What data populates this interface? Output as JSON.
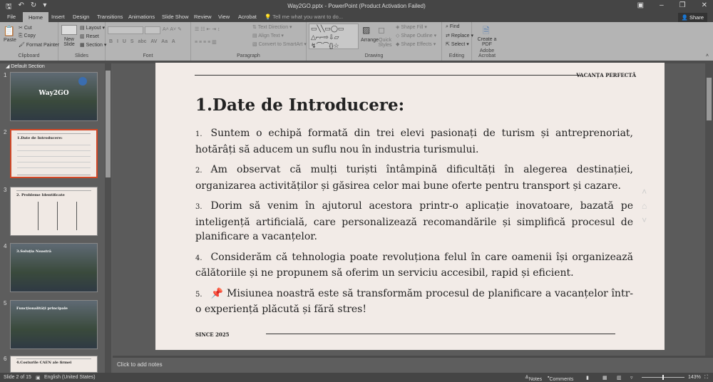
{
  "app": {
    "title": "Way2GO.pptx - PowerPoint (Product Activation Failed)"
  },
  "tabs": [
    "File",
    "Home",
    "Insert",
    "Design",
    "Transitions",
    "Animations",
    "Slide Show",
    "Review",
    "View",
    "Acrobat"
  ],
  "tell_me": "Tell me what you want to do...",
  "share": "Share",
  "ribbon": {
    "clipboard": {
      "label": "Clipboard",
      "paste": "Paste",
      "cut": "Cut",
      "copy": "Copy",
      "format_painter": "Format Painter"
    },
    "slides": {
      "label": "Slides",
      "new_slide": "New Slide",
      "layout": "Layout",
      "reset": "Reset",
      "section": "Section"
    },
    "font": {
      "label": "Font"
    },
    "paragraph": {
      "label": "Paragraph",
      "text_direction": "Text Direction",
      "align_text": "Align Text",
      "convert": "Convert to SmartArt"
    },
    "drawing": {
      "label": "Drawing",
      "arrange": "Arrange",
      "quick_styles": "Quick Styles",
      "shape_fill": "Shape Fill",
      "shape_outline": "Shape Outline",
      "shape_effects": "Shape Effects"
    },
    "editing": {
      "label": "Editing",
      "find": "Find",
      "replace": "Replace",
      "select": "Select"
    },
    "acrobat": {
      "label": "Adobe Acrobat",
      "create_pdf": "Create a PDF"
    }
  },
  "panel": {
    "section": "Default Section",
    "thumbs": [
      {
        "num": "1",
        "title": "Way2GO"
      },
      {
        "num": "2",
        "title": "1.Date de Introducere:"
      },
      {
        "num": "3",
        "title": "2. Probleme Identificate"
      },
      {
        "num": "4",
        "title": "3.Soluția Noastră"
      },
      {
        "num": "5",
        "title": "Funcționalități principale"
      },
      {
        "num": "6",
        "title": "4.Costurile CAEN ale firmei"
      }
    ]
  },
  "slide": {
    "header": "VACANȚA PERFECTĂ",
    "title": "1.Date de Introducere:",
    "items": [
      {
        "num": "1.",
        "text": "Suntem o echipă formată din trei elevi pasionați de turism și antreprenoriat, hotărâți să aducem un suflu nou în industria turismului."
      },
      {
        "num": "2.",
        "text": "Am observat că mulți turiști întâmpină dificultăți în alegerea destinației, organizarea activităților și găsirea celor mai bune oferte pentru transport și cazare."
      },
      {
        "num": "3.",
        "text": "Dorim să venim în ajutorul acestora printr-o aplicație inovatoare, bazată pe inteligență artificială, care personalizează recomandările și simplifică procesul de planificare a vacanțelor."
      },
      {
        "num": "4.",
        "text": "Considerăm că tehnologia poate revoluționa felul în care oamenii își organizează călătoriile și ne propunem să oferim un serviciu accesibil, rapid și eficient."
      },
      {
        "num": "5.",
        "text": "📌 Misiunea noastră este să transformăm procesul de planificare a vacanțelor într-o experiență plăcută și fără stres!"
      }
    ],
    "footer": "SINCE 2025"
  },
  "notes_placeholder": "Click to add notes",
  "status": {
    "slide": "Slide 2 of 15",
    "language": "English (United States)",
    "notes": "Notes",
    "comments": "Comments",
    "zoom": "143%"
  }
}
